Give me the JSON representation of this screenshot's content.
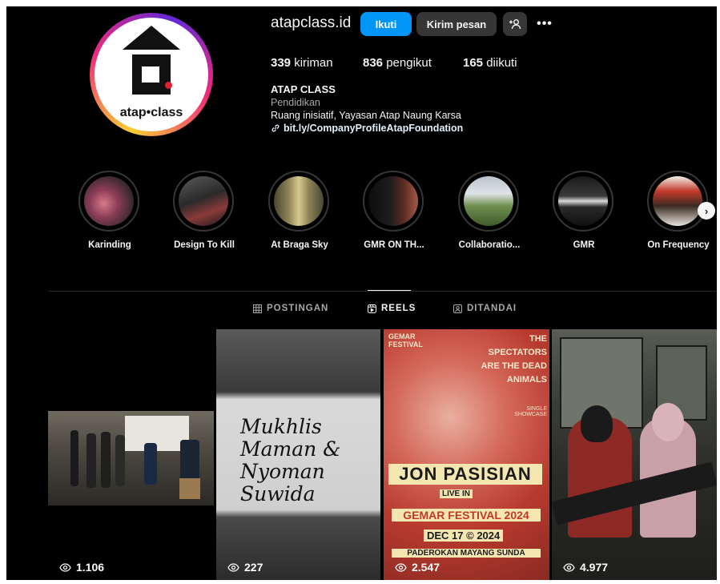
{
  "profile": {
    "username": "atapclass.id",
    "logo_text": "atap•class",
    "follow_label": "Ikuti",
    "message_label": "Kirim pesan",
    "stats": {
      "posts_count": "339",
      "posts_label": "kiriman",
      "followers_count": "836",
      "followers_label": "pengikut",
      "following_count": "165",
      "following_label": "diikuti"
    },
    "bio": {
      "name": "ATAP CLASS",
      "category": "Pendidikan",
      "text": "Ruang inisiatif, Yayasan Atap Naung Karsa",
      "link": "bit.ly/CompanyProfileAtapFoundation"
    }
  },
  "highlights": [
    {
      "label": "Karinding"
    },
    {
      "label": "Design To Kill"
    },
    {
      "label": "At Braga Sky"
    },
    {
      "label": "GMR ON TH..."
    },
    {
      "label": "Collaboratio..."
    },
    {
      "label": "GMR"
    },
    {
      "label": "On Frequency"
    }
  ],
  "tabs": [
    {
      "label": "POSTINGAN",
      "icon": "grid-icon",
      "active": false
    },
    {
      "label": "REELS",
      "icon": "reels-icon",
      "active": true
    },
    {
      "label": "DITANDAI",
      "icon": "tagged-icon",
      "active": false
    }
  ],
  "reels": [
    {
      "views": "1.106"
    },
    {
      "views": "227",
      "poster_text": [
        "Mukhlis",
        "Maman &",
        "Nyoman",
        "Suwida"
      ]
    },
    {
      "views": "2.547",
      "poster_text": [
        "GEMAR FESTIVAL",
        "THE SPECTATORS ARE THE DEAD ANIMALS",
        "SINGLE SHOWCASE",
        "JON PASISIAN",
        "LIVE IN",
        "GEMAR FESTIVAL 2024",
        "DEC 17 © 2024",
        "PADEROKAN MAYANG SUNDA"
      ]
    },
    {
      "views": "4.977"
    }
  ],
  "colors": {
    "background": "#000000",
    "follow_button": "#0095f6",
    "secondary_button": "#363636",
    "muted_text": "#a8a8a8",
    "link_text": "#e0f1ff"
  }
}
